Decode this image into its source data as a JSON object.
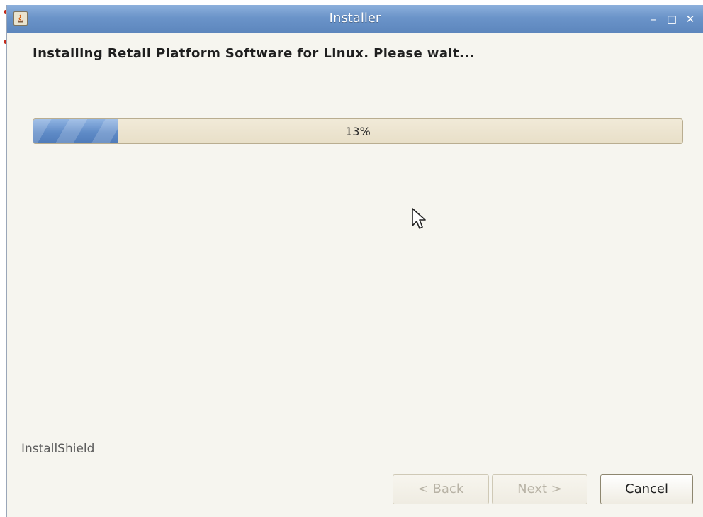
{
  "window": {
    "title": "Installer",
    "controls": {
      "minimize": "–",
      "maximize": "□",
      "close": "✕"
    }
  },
  "main": {
    "heading": "Installing Retail Platform Software for Linux. Please wait..."
  },
  "progress": {
    "value_fraction": 0.13,
    "label": "13%"
  },
  "footer": {
    "brand": "InstallShield",
    "buttons": {
      "back": {
        "prefix": "< ",
        "mnemonic": "B",
        "rest": "ack",
        "enabled": false
      },
      "next": {
        "prefix": "",
        "mnemonic": "N",
        "rest": "ext >",
        "enabled": false
      },
      "cancel": {
        "prefix": "",
        "mnemonic": "C",
        "rest": "ancel",
        "enabled": true
      }
    }
  },
  "colors": {
    "titlebar": "#6b94c9",
    "progress_fill": "#5f8bc7",
    "progress_track": "#e8dfc8",
    "window_bg": "#f6f5ef"
  },
  "icons": {
    "app": "java-installer-icon",
    "cursor": "mouse-pointer-icon"
  }
}
